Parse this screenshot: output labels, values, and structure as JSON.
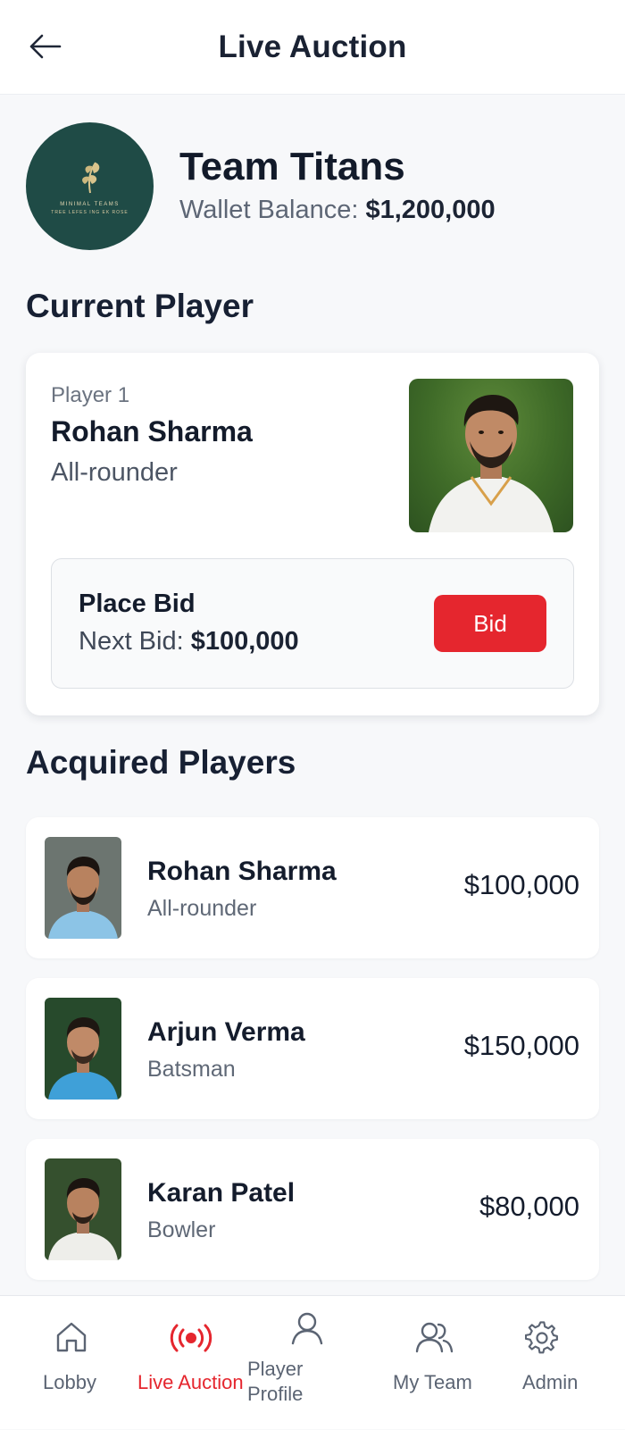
{
  "header": {
    "title": "Live Auction",
    "back_icon": "arrow-left-icon"
  },
  "team": {
    "name": "Team Titans",
    "wallet_label": "Wallet Balance:",
    "wallet_value": "$1,200,000",
    "logo_text": "MINIMAL TEAMS",
    "logo_subtext": "TREE LEFES ING EK ROSE"
  },
  "current_player_section": {
    "title": "Current Player"
  },
  "current_player": {
    "index_label": "Player 1",
    "name": "Rohan Sharma",
    "role": "All-rounder",
    "bid": {
      "title": "Place Bid",
      "next_label": "Next Bid:",
      "next_value": "$100,000",
      "button_label": "Bid"
    }
  },
  "acquired_section": {
    "title": "Acquired Players"
  },
  "acquired_players": [
    {
      "name": "Rohan Sharma",
      "role": "All-rounder",
      "price": "$100,000"
    },
    {
      "name": "Arjun Verma",
      "role": "Batsman",
      "price": "$150,000"
    },
    {
      "name": "Karan Patel",
      "role": "Bowler",
      "price": "$80,000"
    }
  ],
  "nav": {
    "items": [
      {
        "label": "Lobby",
        "icon": "home-icon",
        "active": false
      },
      {
        "label": "Live Auction",
        "icon": "live-broadcast-icon",
        "active": true
      },
      {
        "label": "Player Profile",
        "icon": "user-icon",
        "active": false
      },
      {
        "label": "My Team",
        "icon": "users-icon",
        "active": false
      },
      {
        "label": "Admin",
        "icon": "gear-icon",
        "active": false
      }
    ]
  },
  "colors": {
    "accent": "#e5262e",
    "logo_bg": "#1f4b46",
    "text_dark": "#1a2233",
    "background": "#f7f8fa"
  }
}
